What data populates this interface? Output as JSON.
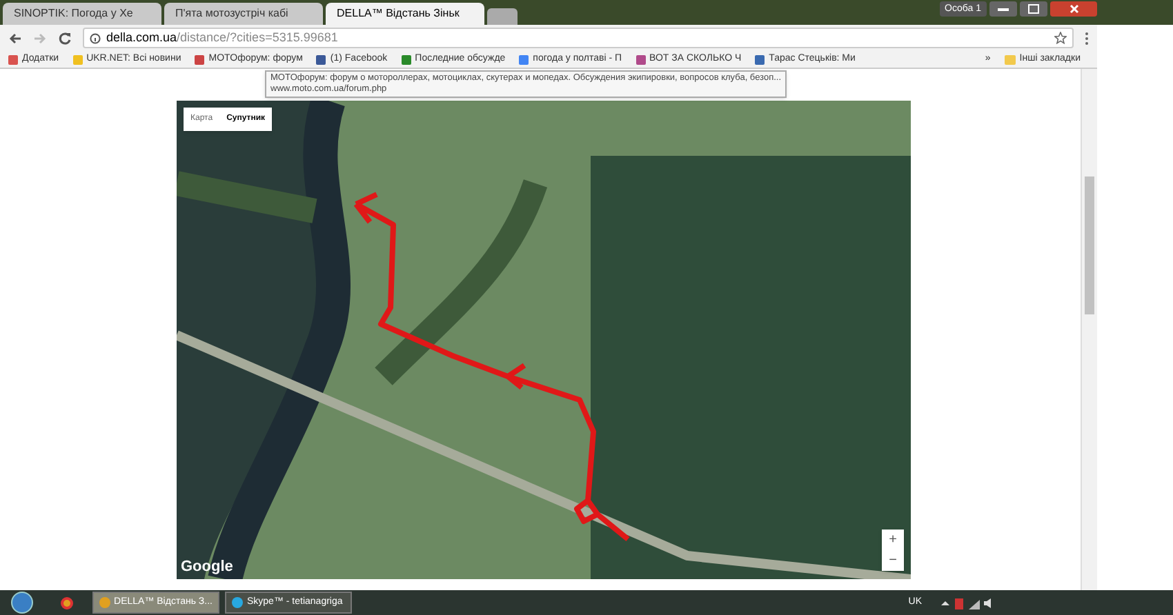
{
  "window": {
    "user_button": "Особа 1"
  },
  "tabs": [
    {
      "title": "SINOPTIK: Погода у Хе",
      "selected": false
    },
    {
      "title": "П'ята мотозустріч кабі",
      "selected": false
    },
    {
      "title": "DELLA™ Відстань Зіньк",
      "selected": true
    }
  ],
  "address_bar": {
    "host": "della.com.ua",
    "path": "/distance/?cities=5315.99681"
  },
  "bookmarks": [
    "Додатки",
    "UKR.NET: Всі новини",
    "MOTOфорум: форум",
    "(1) Facebook",
    "Последние обсужде",
    "погода у полтаві - П",
    "ВОТ ЗА СКОЛЬКО Ч",
    "Тарас Стецьків: Ми"
  ],
  "bookmarks_overflow": "»",
  "other_bookmarks": "Інші закладки",
  "tooltip": {
    "title": "MOTOфорум: форум о мотороллерах, мотоциклах, скутерах и мопедах. Обсуждения экипировки, вопросов клуба, безоп...",
    "url": "www.moto.com.ua/forum.php"
  },
  "map": {
    "types": [
      {
        "label": "Карта",
        "selected": false
      },
      {
        "label": "Супутник",
        "selected": true
      }
    ],
    "logo": "Google",
    "zoom_in": "+",
    "zoom_out": "−"
  },
  "taskbar": {
    "items": [
      {
        "label": "DELLA™ Відстань З...",
        "selected": true
      },
      {
        "label": "Skype™ - tetianagriga",
        "selected": false
      }
    ],
    "language": "UK"
  }
}
